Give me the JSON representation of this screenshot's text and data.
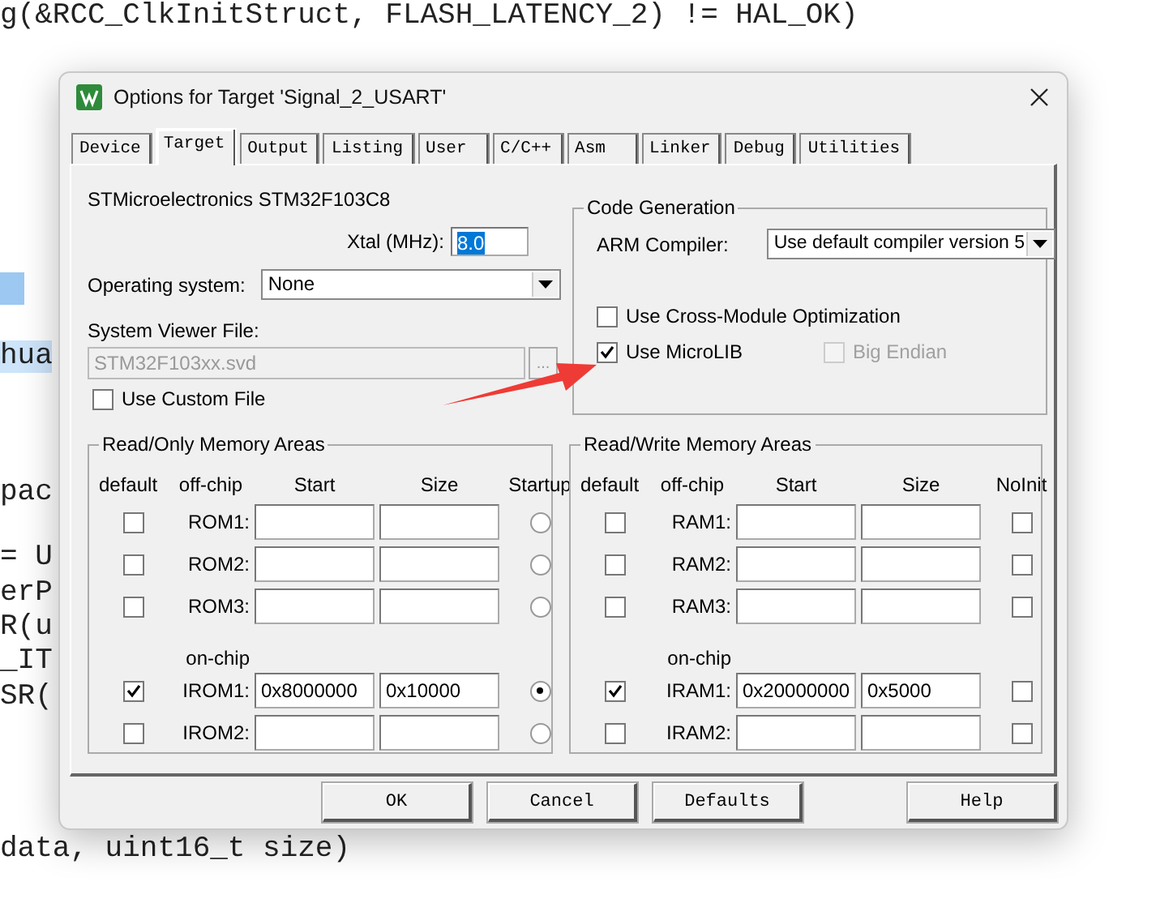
{
  "editor": {
    "lines": [
      {
        "kind": "code",
        "text": "g(&RCC_ClkInitStruct, FLASH_LATENCY_2) != HAL_OK)",
        "highlighted": false
      },
      {
        "kind": "selection"
      },
      {
        "kind": "code",
        "text": "hua",
        "highlighted": true
      },
      {
        "kind": "code",
        "text": "pac",
        "highlighted": false
      },
      {
        "kind": "code",
        "text": "= U",
        "highlighted": false
      },
      {
        "kind": "code",
        "text": "erP",
        "highlighted": false
      },
      {
        "kind": "code",
        "text": "R(u",
        "highlighted": false
      },
      {
        "kind": "code",
        "text": "_IT",
        "highlighted": false
      },
      {
        "kind": "code",
        "text": "SR(",
        "highlighted": false
      },
      {
        "kind": "code",
        "text": "data, uint16_t size)",
        "highlighted": false
      }
    ]
  },
  "window": {
    "title": "Options for Target 'Signal_2_USART'"
  },
  "tabs": [
    {
      "label": "Device",
      "selected": false
    },
    {
      "label": "Target",
      "selected": true
    },
    {
      "label": "Output",
      "selected": false
    },
    {
      "label": "Listing",
      "selected": false
    },
    {
      "label": "User",
      "selected": false
    },
    {
      "label": "C/C++",
      "selected": false
    },
    {
      "label": "Asm",
      "selected": false
    },
    {
      "label": "Linker",
      "selected": false
    },
    {
      "label": "Debug",
      "selected": false
    },
    {
      "label": "Utilities",
      "selected": false
    }
  ],
  "device": "STMicroelectronics STM32F103C8",
  "xtal": {
    "label": "Xtal (MHz):",
    "value": "8.0"
  },
  "operating_system": {
    "label": "Operating system:",
    "value": "None"
  },
  "system_viewer": {
    "label": "System Viewer File:",
    "value": "STM32F103xx.svd",
    "browse": "...",
    "custom_label": "Use Custom File",
    "custom_checked": false
  },
  "code_generation": {
    "title": "Code Generation",
    "compiler_label": "ARM Compiler:",
    "compiler_value": "Use default compiler version 5",
    "options": [
      {
        "label": "Use Cross-Module Optimization",
        "checked": false,
        "disabled": false
      },
      {
        "label": "Use MicroLIB",
        "checked": true,
        "disabled": false
      },
      {
        "label": "Big Endian",
        "checked": false,
        "disabled": true
      }
    ]
  },
  "rom_areas": {
    "title": "Read/Only Memory Areas",
    "columns": [
      "default",
      "off-chip",
      "Start",
      "Size",
      "Startup"
    ],
    "rows": [
      {
        "kind": "row",
        "default": false,
        "label": "ROM1:",
        "flag": false
      },
      {
        "kind": "row",
        "default": false,
        "label": "ROM2:",
        "flag": false
      },
      {
        "kind": "row",
        "default": false,
        "label": "ROM3:",
        "flag": false
      },
      {
        "kind": "section",
        "label": "on-chip"
      },
      {
        "kind": "row",
        "default": true,
        "label": "IROM1:",
        "start": "0x8000000",
        "size": "0x10000",
        "flag": true
      },
      {
        "kind": "row",
        "default": false,
        "label": "IROM2:",
        "flag": false
      }
    ]
  },
  "ram_areas": {
    "title": "Read/Write Memory Areas",
    "columns": [
      "default",
      "off-chip",
      "Start",
      "Size",
      "NoInit"
    ],
    "rows": [
      {
        "kind": "row",
        "default": false,
        "label": "RAM1:",
        "flag": false
      },
      {
        "kind": "row",
        "default": false,
        "label": "RAM2:",
        "flag": false
      },
      {
        "kind": "row",
        "default": false,
        "label": "RAM3:",
        "flag": false
      },
      {
        "kind": "section",
        "label": "on-chip"
      },
      {
        "kind": "row",
        "default": true,
        "label": "IRAM1:",
        "start": "0x20000000",
        "size": "0x5000",
        "flag": false
      },
      {
        "kind": "row",
        "default": false,
        "label": "IRAM2:",
        "flag": false
      }
    ]
  },
  "buttons": [
    "OK",
    "Cancel",
    "Defaults",
    "Help"
  ]
}
